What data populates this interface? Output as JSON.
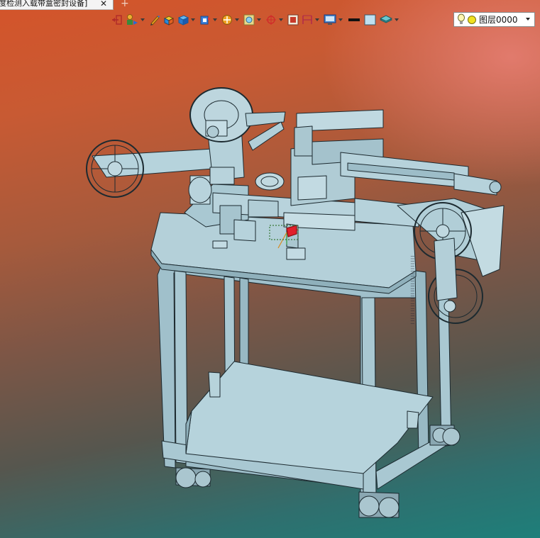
{
  "document_tab": {
    "title": "度检测入载带盒密封设备]",
    "close_glyph": "✕",
    "add_glyph": "+"
  },
  "toolbar": {
    "buttons": [
      {
        "name": "exit-sketch",
        "icon": "exit-icon",
        "has_dropdown": false
      },
      {
        "name": "user-coordinate",
        "icon": "user-coordinate-icon",
        "has_dropdown": true
      },
      {
        "name": "sketch-pen",
        "icon": "pen-icon",
        "has_dropdown": false
      },
      {
        "name": "render-part",
        "icon": "part-render-icon",
        "has_dropdown": false
      },
      {
        "name": "display-style",
        "icon": "solid-box-icon",
        "has_dropdown": true
      },
      {
        "name": "view-orientation",
        "icon": "view-cube-icon",
        "has_dropdown": true
      },
      {
        "name": "section-view",
        "icon": "section-icon",
        "has_dropdown": true
      },
      {
        "name": "zoom-view",
        "icon": "zoom-icon",
        "has_dropdown": true
      },
      {
        "name": "snap-point",
        "icon": "snap-icon",
        "has_dropdown": true
      },
      {
        "name": "grid-toggle",
        "icon": "grid-icon",
        "has_dropdown": false
      },
      {
        "name": "measure-tool",
        "icon": "measure-icon",
        "has_dropdown": true
      },
      {
        "name": "screen-capture",
        "icon": "monitor-icon",
        "has_dropdown": true
      },
      {
        "name": "line-color",
        "icon": "line-color-icon",
        "has_dropdown": false
      },
      {
        "name": "fill-color",
        "icon": "fill-color-icon",
        "has_dropdown": false
      },
      {
        "name": "layer-manager",
        "icon": "layers-icon",
        "has_dropdown": true
      }
    ]
  },
  "layer": {
    "current": "图层0000"
  },
  "colors": {
    "model_fill": "#a9c8d2",
    "model_edge": "#1c2a30",
    "background_top": "#d4542a",
    "background_bottom": "#1e7f7a"
  }
}
